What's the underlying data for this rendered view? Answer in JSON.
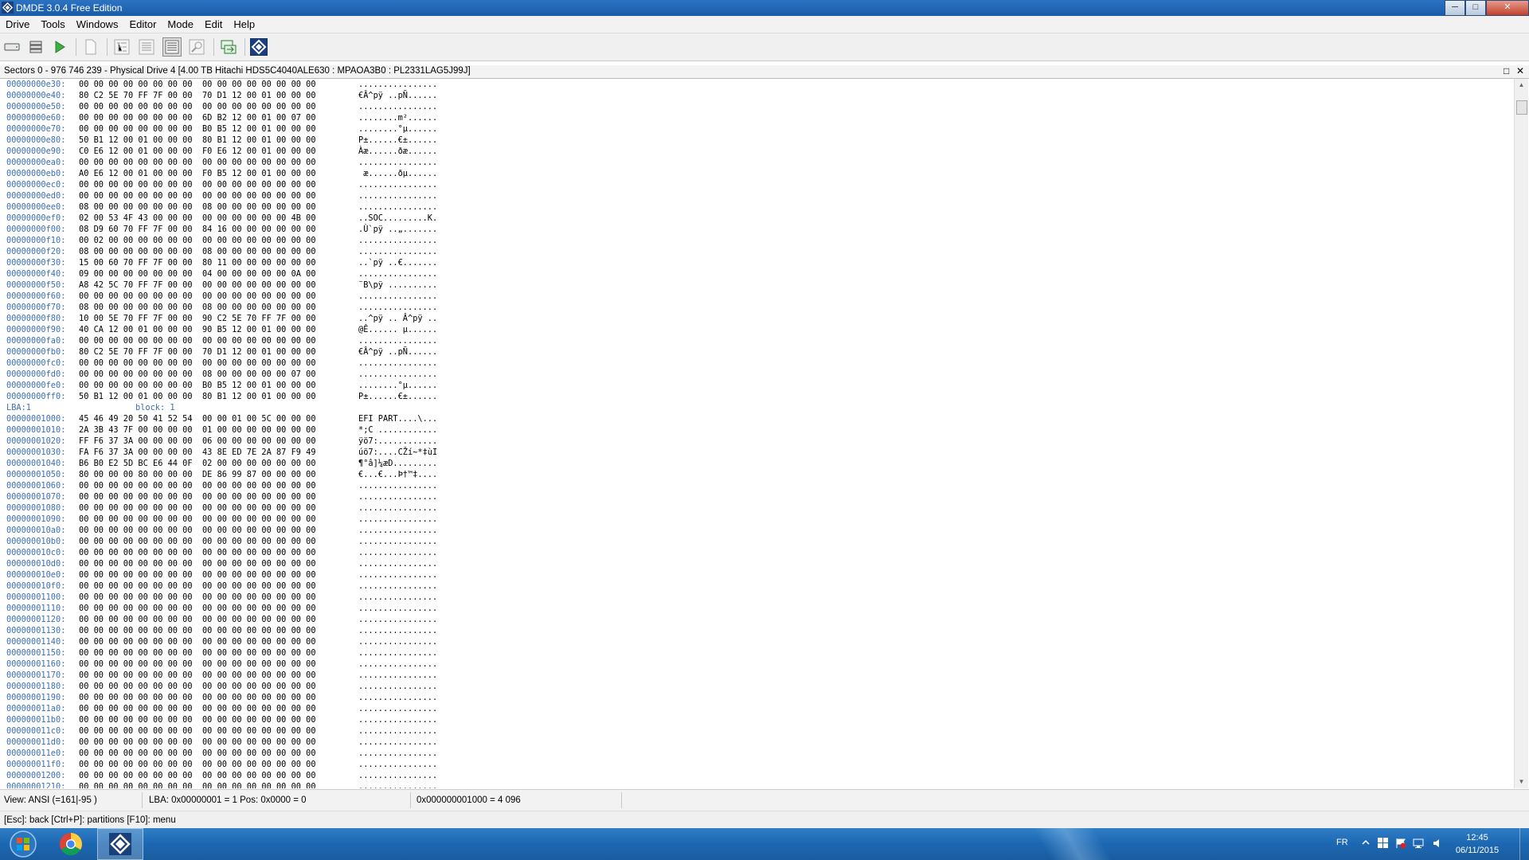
{
  "window": {
    "title": "DMDE 3.0.4 Free Edition",
    "controls": {
      "minimize": "─",
      "maximize": "□",
      "close": "✕"
    }
  },
  "menu": [
    "Drive",
    "Tools",
    "Windows",
    "Editor",
    "Mode",
    "Edit",
    "Help"
  ],
  "toolbar": {
    "buttons": [
      {
        "name": "drive-open-icon"
      },
      {
        "name": "partitions-icon"
      },
      {
        "name": "play-icon"
      },
      {
        "name": "new-file-icon"
      },
      {
        "name": "tree-view-icon"
      },
      {
        "name": "list-view-icon"
      },
      {
        "name": "hex-view-icon",
        "active": true
      },
      {
        "name": "find-icon"
      },
      {
        "name": "copy-sectors-icon"
      },
      {
        "name": "dmde-logo-icon"
      }
    ]
  },
  "drive_header": {
    "text": "Sectors 0 - 976 746 239 - Physical Drive 4 [4.00 TB Hitachi HDS5C4040ALE630 : MPAOA3B0 : PL2331LAG5J99J]",
    "restore": "□",
    "close": "✕"
  },
  "hex_rows": [
    {
      "addr": "00000000e30:",
      "bytes": "00 00 00 00 00 00 00 00  00 00 00 00 00 00 00 00",
      "ascii": "................"
    },
    {
      "addr": "00000000e40:",
      "bytes": "80 C2 5E 70 FF 7F 00 00  70 D1 12 00 01 00 00 00",
      "ascii": "€Â^pÿ ..pÑ......"
    },
    {
      "addr": "00000000e50:",
      "bytes": "00 00 00 00 00 00 00 00  00 00 00 00 00 00 00 00",
      "ascii": "................"
    },
    {
      "addr": "00000000e60:",
      "bytes": "00 00 00 00 00 00 00 00  6D B2 12 00 01 00 07 00",
      "ascii": "........m²......"
    },
    {
      "addr": "00000000e70:",
      "bytes": "00 00 00 00 00 00 00 00  B0 B5 12 00 01 00 00 00",
      "ascii": "........°µ......"
    },
    {
      "addr": "00000000e80:",
      "bytes": "50 B1 12 00 01 00 00 00  80 B1 12 00 01 00 00 00",
      "ascii": "P±......€±......"
    },
    {
      "addr": "00000000e90:",
      "bytes": "C0 E6 12 00 01 00 00 00  F0 E6 12 00 01 00 00 00",
      "ascii": "Àæ......ðæ......"
    },
    {
      "addr": "00000000ea0:",
      "bytes": "00 00 00 00 00 00 00 00  00 00 00 00 00 00 00 00",
      "ascii": "................"
    },
    {
      "addr": "00000000eb0:",
      "bytes": "A0 E6 12 00 01 00 00 00  F0 B5 12 00 01 00 00 00",
      "ascii": " æ......ðµ......"
    },
    {
      "addr": "00000000ec0:",
      "bytes": "00 00 00 00 00 00 00 00  00 00 00 00 00 00 00 00",
      "ascii": "................"
    },
    {
      "addr": "00000000ed0:",
      "bytes": "00 00 00 00 00 00 00 00  00 00 00 00 00 00 00 00",
      "ascii": "................"
    },
    {
      "addr": "00000000ee0:",
      "bytes": "08 00 00 00 00 00 00 00  08 00 00 00 00 00 00 00",
      "ascii": "................"
    },
    {
      "addr": "00000000ef0:",
      "bytes": "02 00 53 4F 43 00 00 00  00 00 00 00 00 00 4B 00",
      "ascii": "..SOC.........K."
    },
    {
      "addr": "00000000f00:",
      "bytes": "08 D9 60 70 FF 7F 00 00  84 16 00 00 00 00 00 00",
      "ascii": ".Ù`pÿ ..„......."
    },
    {
      "addr": "00000000f10:",
      "bytes": "00 02 00 00 00 00 00 00  00 00 00 00 00 00 00 00",
      "ascii": "................"
    },
    {
      "addr": "00000000f20:",
      "bytes": "08 00 00 00 00 00 00 00  08 00 00 00 00 00 00 00",
      "ascii": "................"
    },
    {
      "addr": "00000000f30:",
      "bytes": "15 00 60 70 FF 7F 00 00  80 11 00 00 00 00 00 00",
      "ascii": "..`pÿ ..€......."
    },
    {
      "addr": "00000000f40:",
      "bytes": "09 00 00 00 00 00 00 00  04 00 00 00 00 00 0A 00",
      "ascii": "................"
    },
    {
      "addr": "00000000f50:",
      "bytes": "A8 42 5C 70 FF 7F 00 00  00 00 00 00 00 00 00 00",
      "ascii": "¨B\\pÿ .........."
    },
    {
      "addr": "00000000f60:",
      "bytes": "00 00 00 00 00 00 00 00  00 00 00 00 00 00 00 00",
      "ascii": "................"
    },
    {
      "addr": "00000000f70:",
      "bytes": "08 00 00 00 00 00 00 00  08 00 00 00 00 00 00 00",
      "ascii": "................"
    },
    {
      "addr": "00000000f80:",
      "bytes": "10 00 5E 70 FF 7F 00 00  90 C2 5E 70 FF 7F 00 00",
      "ascii": "..^pÿ .. Â^pÿ .."
    },
    {
      "addr": "00000000f90:",
      "bytes": "40 CA 12 00 01 00 00 00  90 B5 12 00 01 00 00 00",
      "ascii": "@Ê...... µ......"
    },
    {
      "addr": "00000000fa0:",
      "bytes": "00 00 00 00 00 00 00 00  00 00 00 00 00 00 00 00",
      "ascii": "................"
    },
    {
      "addr": "00000000fb0:",
      "bytes": "80 C2 5E 70 FF 7F 00 00  70 D1 12 00 01 00 00 00",
      "ascii": "€Â^pÿ ..pÑ......"
    },
    {
      "addr": "00000000fc0:",
      "bytes": "00 00 00 00 00 00 00 00  00 00 00 00 00 00 00 00",
      "ascii": "................"
    },
    {
      "addr": "00000000fd0:",
      "bytes": "00 00 00 00 00 00 00 00  08 00 00 00 00 00 07 00",
      "ascii": "................"
    },
    {
      "addr": "00000000fe0:",
      "bytes": "00 00 00 00 00 00 00 00  B0 B5 12 00 01 00 00 00",
      "ascii": "........°µ......"
    },
    {
      "addr": "00000000ff0:",
      "bytes": "50 B1 12 00 01 00 00 00  80 B1 12 00 01 00 00 00",
      "ascii": "P±......€±......"
    },
    {
      "label": "LBA:1",
      "block": "block: 1"
    },
    {
      "addr": "00000001000:",
      "bytes": "45 46 49 20 50 41 52 54  00 00 01 00 5C 00 00 00",
      "ascii": "EFI PART....\\..."
    },
    {
      "addr": "00000001010:",
      "bytes": "2A 3B 43 7F 00 00 00 00  01 00 00 00 00 00 00 00",
      "ascii": "*;C ............"
    },
    {
      "addr": "00000001020:",
      "bytes": "FF F6 37 3A 00 00 00 00  06 00 00 00 00 00 00 00",
      "ascii": "ÿö7:............"
    },
    {
      "addr": "00000001030:",
      "bytes": "FA F6 37 3A 00 00 00 00  43 8E ED 7E 2A 87 F9 49",
      "ascii": "úö7:....CŽí~*‡ùI"
    },
    {
      "addr": "00000001040:",
      "bytes": "B6 B0 E2 5D BC E6 44 0F  02 00 00 00 00 00 00 00",
      "ascii": "¶°â]¼æD........."
    },
    {
      "addr": "00000001050:",
      "bytes": "80 00 00 00 80 00 00 00  DE 86 99 87 00 00 00 00",
      "ascii": "€...€...Þ†™‡...."
    },
    {
      "addr": "00000001060:",
      "bytes": "00 00 00 00 00 00 00 00  00 00 00 00 00 00 00 00",
      "ascii": "................"
    },
    {
      "addr": "00000001070:",
      "bytes": "00 00 00 00 00 00 00 00  00 00 00 00 00 00 00 00",
      "ascii": "................"
    },
    {
      "addr": "00000001080:",
      "bytes": "00 00 00 00 00 00 00 00  00 00 00 00 00 00 00 00",
      "ascii": "................"
    },
    {
      "addr": "00000001090:",
      "bytes": "00 00 00 00 00 00 00 00  00 00 00 00 00 00 00 00",
      "ascii": "................"
    },
    {
      "addr": "000000010a0:",
      "bytes": "00 00 00 00 00 00 00 00  00 00 00 00 00 00 00 00",
      "ascii": "................"
    },
    {
      "addr": "000000010b0:",
      "bytes": "00 00 00 00 00 00 00 00  00 00 00 00 00 00 00 00",
      "ascii": "................"
    },
    {
      "addr": "000000010c0:",
      "bytes": "00 00 00 00 00 00 00 00  00 00 00 00 00 00 00 00",
      "ascii": "................"
    },
    {
      "addr": "000000010d0:",
      "bytes": "00 00 00 00 00 00 00 00  00 00 00 00 00 00 00 00",
      "ascii": "................"
    },
    {
      "addr": "000000010e0:",
      "bytes": "00 00 00 00 00 00 00 00  00 00 00 00 00 00 00 00",
      "ascii": "................"
    },
    {
      "addr": "000000010f0:",
      "bytes": "00 00 00 00 00 00 00 00  00 00 00 00 00 00 00 00",
      "ascii": "................"
    },
    {
      "addr": "00000001100:",
      "bytes": "00 00 00 00 00 00 00 00  00 00 00 00 00 00 00 00",
      "ascii": "................"
    },
    {
      "addr": "00000001110:",
      "bytes": "00 00 00 00 00 00 00 00  00 00 00 00 00 00 00 00",
      "ascii": "................"
    },
    {
      "addr": "00000001120:",
      "bytes": "00 00 00 00 00 00 00 00  00 00 00 00 00 00 00 00",
      "ascii": "................"
    },
    {
      "addr": "00000001130:",
      "bytes": "00 00 00 00 00 00 00 00  00 00 00 00 00 00 00 00",
      "ascii": "................"
    },
    {
      "addr": "00000001140:",
      "bytes": "00 00 00 00 00 00 00 00  00 00 00 00 00 00 00 00",
      "ascii": "................"
    },
    {
      "addr": "00000001150:",
      "bytes": "00 00 00 00 00 00 00 00  00 00 00 00 00 00 00 00",
      "ascii": "................"
    },
    {
      "addr": "00000001160:",
      "bytes": "00 00 00 00 00 00 00 00  00 00 00 00 00 00 00 00",
      "ascii": "................"
    },
    {
      "addr": "00000001170:",
      "bytes": "00 00 00 00 00 00 00 00  00 00 00 00 00 00 00 00",
      "ascii": "................"
    },
    {
      "addr": "00000001180:",
      "bytes": "00 00 00 00 00 00 00 00  00 00 00 00 00 00 00 00",
      "ascii": "................"
    },
    {
      "addr": "00000001190:",
      "bytes": "00 00 00 00 00 00 00 00  00 00 00 00 00 00 00 00",
      "ascii": "................"
    },
    {
      "addr": "000000011a0:",
      "bytes": "00 00 00 00 00 00 00 00  00 00 00 00 00 00 00 00",
      "ascii": "................"
    },
    {
      "addr": "000000011b0:",
      "bytes": "00 00 00 00 00 00 00 00  00 00 00 00 00 00 00 00",
      "ascii": "................"
    },
    {
      "addr": "000000011c0:",
      "bytes": "00 00 00 00 00 00 00 00  00 00 00 00 00 00 00 00",
      "ascii": "................"
    },
    {
      "addr": "000000011d0:",
      "bytes": "00 00 00 00 00 00 00 00  00 00 00 00 00 00 00 00",
      "ascii": "................"
    },
    {
      "addr": "000000011e0:",
      "bytes": "00 00 00 00 00 00 00 00  00 00 00 00 00 00 00 00",
      "ascii": "................"
    },
    {
      "addr": "000000011f0:",
      "bytes": "00 00 00 00 00 00 00 00  00 00 00 00 00 00 00 00",
      "ascii": "................"
    },
    {
      "addr": "00000001200:",
      "bytes": "00 00 00 00 00 00 00 00  00 00 00 00 00 00 00 00",
      "ascii": "................"
    },
    {
      "addr": "00000001210:",
      "bytes": "00 00 00 00 00 00 00 00  00 00 00 00 00 00 00 00",
      "ascii": "................"
    }
  ],
  "status": {
    "view": "View:   ANSI (=161|-95 )",
    "lba": "LBA: 0x00000001 = 1   Pos: 0x0000 = 0",
    "offset": "0x000000001000 = 4 096"
  },
  "hints": "[Esc]: back  [Ctrl+P]: partitions  [F10]: menu",
  "taskbar": {
    "items": [
      {
        "name": "start-orb-icon"
      },
      {
        "name": "chrome-icon"
      },
      {
        "name": "dmde-taskbar-icon",
        "active": true
      }
    ],
    "tray": {
      "language": "FR",
      "time": "12:45",
      "date": "06/11/2015"
    }
  },
  "colors": {
    "address": "#3a6fb8",
    "titlebar": "#1b5ba8",
    "taskbar": "#1d67b2"
  }
}
